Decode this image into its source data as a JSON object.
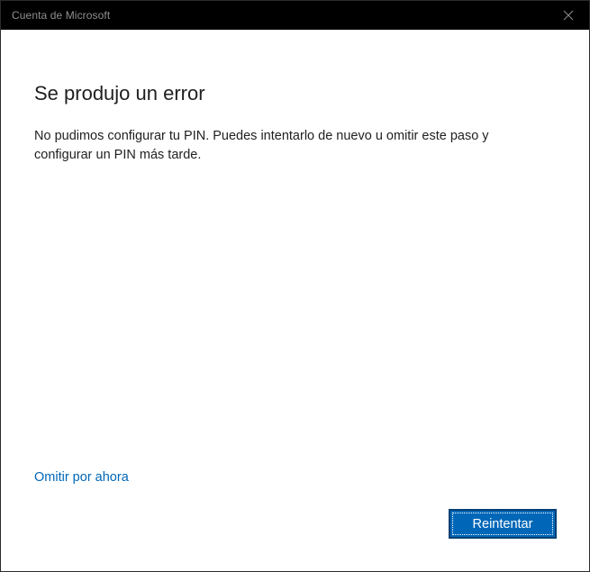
{
  "window": {
    "title": "Cuenta de Microsoft",
    "close_icon": "close-icon"
  },
  "dialog": {
    "heading": "Se produjo un error",
    "message": "No pudimos configurar tu PIN. Puedes intentarlo de nuevo u omitir este paso y configurar un PIN más tarde.",
    "skip_link": "Omitir por ahora",
    "retry_button": "Reintentar"
  },
  "colors": {
    "titlebar": "#000000",
    "accent": "#0067b8",
    "background": "#ffffff"
  }
}
